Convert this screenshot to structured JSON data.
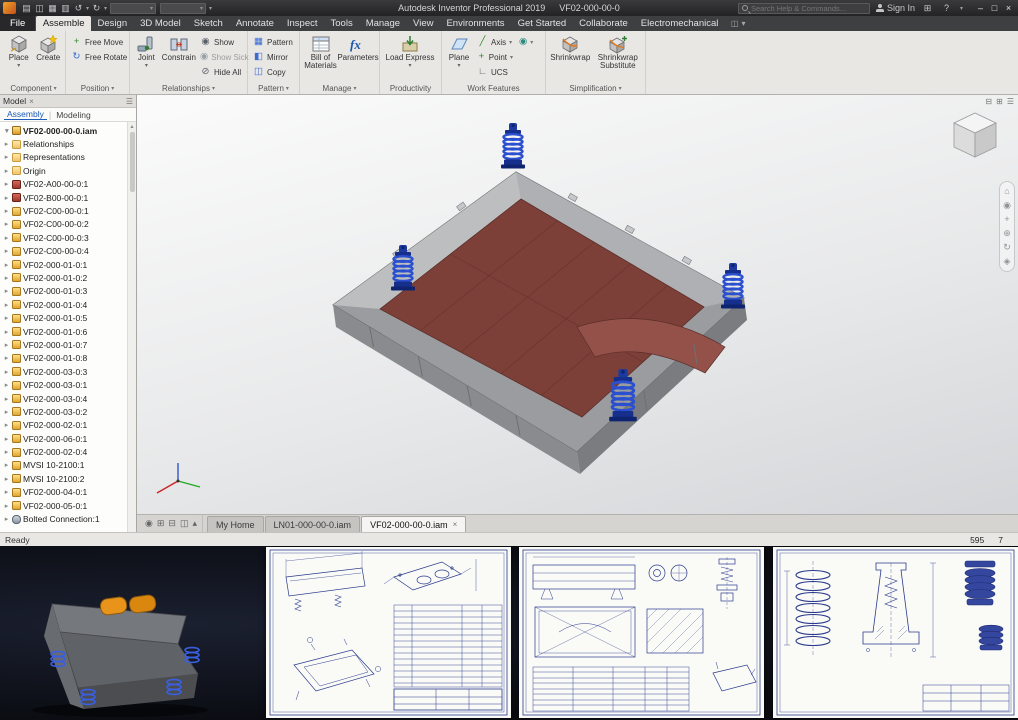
{
  "title_bar": {
    "app_title": "Autodesk Inventor Professional 2019",
    "document_title": "VF02-000-00-0",
    "search_placeholder": "Search Help & Commands...",
    "sign_in_label": "Sign In"
  },
  "icons": {
    "dropdown": "▾",
    "expand_arrow": "▸",
    "close": "×",
    "minimize": "–",
    "maximize": "□",
    "help": "?",
    "new_file": "▤",
    "open": "◫",
    "save": "▦",
    "print": "▥",
    "undo": "↺",
    "redo": "↻",
    "services": "⊞",
    "free_move": "+",
    "free_rotate": "↻",
    "show": "◉",
    "show_sick": "◉",
    "hide_all": "⊘",
    "pattern": "▦",
    "mirror": "◧",
    "copy": "◫",
    "axis": "╱",
    "point": "+",
    "ucs": "∟",
    "point_flyout": "◉",
    "dock_min": "⊟",
    "dock_grid": "⊞",
    "dock_menu": "☰",
    "nav_home": "⌂",
    "nav_wheel": "◉",
    "nav_pan": "+",
    "nav_zoom": "⊕",
    "nav_orbit": "↻",
    "nav_look": "◈",
    "dt_record": "◉",
    "dt_grid": "⊞",
    "dt_split": "⊟",
    "dt_frame": "◫",
    "dt_up": "▴",
    "browser_menu": "☰",
    "scroll_up": "▲"
  },
  "ribbon": {
    "file_tab": "File",
    "tabs": [
      {
        "label": "Assemble",
        "active": "active"
      },
      {
        "label": "Design"
      },
      {
        "label": "3D Model"
      },
      {
        "label": "Sketch"
      },
      {
        "label": "Annotate"
      },
      {
        "label": "Inspect"
      },
      {
        "label": "Tools"
      },
      {
        "label": "Manage"
      },
      {
        "label": "View"
      },
      {
        "label": "Environments"
      },
      {
        "label": "Get Started"
      },
      {
        "label": "Collaborate"
      },
      {
        "label": "Electromechanical"
      }
    ],
    "groups": {
      "component": {
        "label": "Component",
        "place": "Place",
        "create": "Create"
      },
      "position": {
        "label": "Position",
        "free_move": "Free Move",
        "free_rotate": "Free Rotate"
      },
      "relationships": {
        "label": "Relationships",
        "joint": "Joint",
        "constrain": "Constrain",
        "show": "Show",
        "show_sick": "Show Sick",
        "hide_all": "Hide All"
      },
      "pattern": {
        "label": "Pattern",
        "pattern": "Pattern",
        "mirror": "Mirror",
        "copy": "Copy"
      },
      "manage": {
        "label": "Manage",
        "bom": "Bill of Materials",
        "parameters": "Parameters"
      },
      "productivity": {
        "label": "Productivity",
        "load_express": "Load Express"
      },
      "work_features": {
        "label": "Work Features",
        "plane": "Plane",
        "axis": "Axis",
        "point": "Point",
        "ucs": "UCS"
      },
      "simplification": {
        "label": "Simplification",
        "shrinkwrap": "Shrinkwrap",
        "shrinkwrap_substitute": "Shrinkwrap Substitute"
      }
    }
  },
  "browser": {
    "panel_title": "Model",
    "tab_assembly": "Assembly",
    "tab_modeling": "Modeling",
    "tree": [
      {
        "label": "VF02-000-00-0.iam",
        "icon": "assembly",
        "cls": "root"
      },
      {
        "label": "Relationships",
        "icon": "folder"
      },
      {
        "label": "Representations",
        "icon": "folder"
      },
      {
        "label": "Origin",
        "icon": "folder"
      },
      {
        "label": "VF02-A00-00-0:1",
        "icon": "part-red"
      },
      {
        "label": "VF02-B00-00-0:1",
        "icon": "part-red"
      },
      {
        "label": "VF02-C00-00-0:1"
      },
      {
        "label": "VF02-C00-00-0:2"
      },
      {
        "label": "VF02-C00-00-0:3"
      },
      {
        "label": "VF02-C00-00-0:4"
      },
      {
        "label": "VF02-000-01-0:1"
      },
      {
        "label": "VF02-000-01-0:2"
      },
      {
        "label": "VF02-000-01-0:3"
      },
      {
        "label": "VF02-000-01-0:4"
      },
      {
        "label": "VF02-000-01-0:5"
      },
      {
        "label": "VF02-000-01-0:6"
      },
      {
        "label": "VF02-000-01-0:7"
      },
      {
        "label": "VF02-000-01-0:8"
      },
      {
        "label": "VF02-000-03-0:3"
      },
      {
        "label": "VF02-000-03-0:1"
      },
      {
        "label": "VF02-000-03-0:4"
      },
      {
        "label": "VF02-000-03-0:2"
      },
      {
        "label": "VF02-000-02-0:1"
      },
      {
        "label": "VF02-000-06-0:1"
      },
      {
        "label": "VF02-000-02-0:4"
      },
      {
        "label": "MVSI 10-2100:1"
      },
      {
        "label": "MVSI 10-2100:2"
      },
      {
        "label": "VF02-000-04-0:1"
      },
      {
        "label": "VF02-000-05-0:1"
      },
      {
        "label": "Bolted Connection:1",
        "icon": "bolt"
      }
    ]
  },
  "viewport": {
    "doc_tabs": [
      {
        "label": "My Home"
      },
      {
        "label": "LN01-000-00-0.iam"
      },
      {
        "label": "VF02-000-00-0.iam",
        "active": "active",
        "closable": true
      }
    ]
  },
  "status_bar": {
    "message": "Ready",
    "value_1": "595",
    "value_2": "7"
  },
  "colors": {
    "accent_blue": "#2b50cf",
    "deck_maroon": "#7c4038",
    "body_gray": "#9a9c9f",
    "drawing_blue": "#2a3a8c",
    "motor_orange": "#e8941a"
  }
}
